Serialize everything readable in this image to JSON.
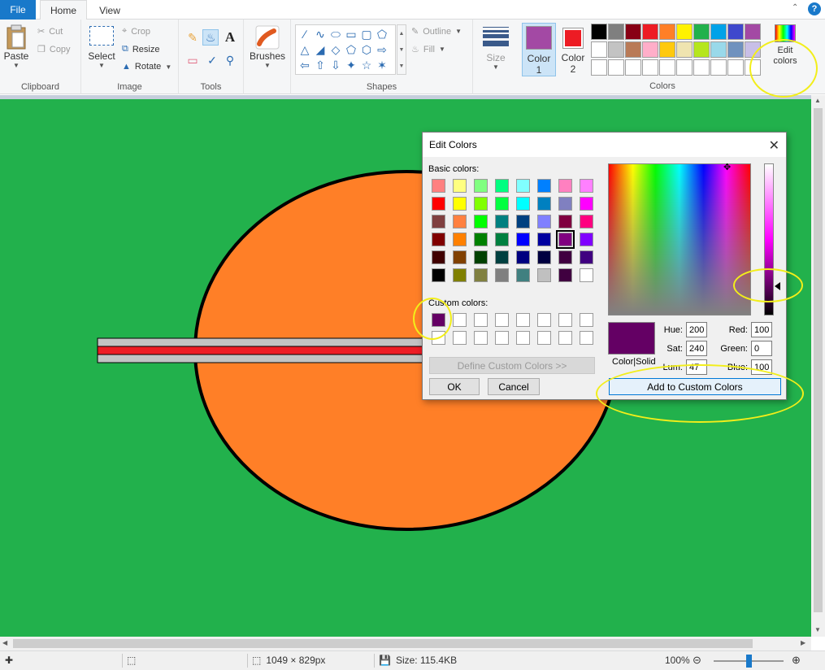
{
  "tabs": {
    "file": "File",
    "home": "Home",
    "view": "View",
    "help": "?"
  },
  "clipboard": {
    "paste": "Paste",
    "cut": "Cut",
    "copy": "Copy",
    "label": "Clipboard"
  },
  "image": {
    "select": "Select",
    "crop": "Crop",
    "resize": "Resize",
    "rotate": "Rotate",
    "label": "Image"
  },
  "tools": {
    "label": "Tools",
    "text_glyph": "A"
  },
  "brushes": {
    "label": "Brushes"
  },
  "shapes": {
    "label": "Shapes",
    "outline": "Outline",
    "fill": "Fill"
  },
  "size": {
    "label": "Size"
  },
  "colors": {
    "label": "Colors",
    "color1_label": "Color\n1",
    "color1_line1": "Color",
    "color1_line2": "1",
    "color2_line1": "Color",
    "color2_line2": "2",
    "color1": "#a349a4",
    "color2": "#ed1c24",
    "edit_line1": "Edit",
    "edit_line2": "colors",
    "palette_row1": [
      "#000000",
      "#7f7f7f",
      "#880015",
      "#ed1c24",
      "#ff7f27",
      "#fff200",
      "#22b14c",
      "#00a2e8",
      "#3f48cc",
      "#a349a4"
    ],
    "palette_row2": [
      "#ffffff",
      "#c3c3c3",
      "#b97a57",
      "#ffaec9",
      "#ffc90e",
      "#efe4b0",
      "#b5e61d",
      "#99d9ea",
      "#7092be",
      "#c8bfe7"
    ],
    "palette_row3": [
      "#ffffff",
      "#ffffff",
      "#ffffff",
      "#ffffff",
      "#ffffff",
      "#ffffff",
      "#ffffff",
      "#ffffff",
      "#ffffff",
      "#ffffff"
    ]
  },
  "canvas": {
    "background": "#22b14c",
    "ellipse_fill": "#ff7f27",
    "bar_fill": "#ed1c24",
    "bar_border": "#c3c3c3"
  },
  "status": {
    "dimensions": "1049 × 829px",
    "size": "Size: 115.4KB",
    "zoom": "100%",
    "zoom_level": 0.5
  },
  "dialog": {
    "title": "Edit Colors",
    "basic_colors_label": "Basic colors:",
    "custom_colors_label": "Custom colors:",
    "define_button": "Define Custom Colors >>",
    "ok": "OK",
    "cancel": "Cancel",
    "color_solid_label": "Color|Solid",
    "add_button": "Add to Custom Colors",
    "hue_label": "Hue:",
    "hue": "200",
    "sat_label": "Sat:",
    "sat": "240",
    "lum_label": "Lum:",
    "lum": "47",
    "red_label": "Red:",
    "red": "100",
    "green_label": "Green:",
    "green": "0",
    "blue_label": "Blue:",
    "blue": "100",
    "preview_color": "#640064",
    "basic_colors": [
      [
        "#ff8080",
        "#ffff80",
        "#80ff80",
        "#00ff80",
        "#80ffff",
        "#0080ff",
        "#ff80c0",
        "#ff80ff"
      ],
      [
        "#ff0000",
        "#ffff00",
        "#80ff00",
        "#00ff40",
        "#00ffff",
        "#0080c0",
        "#8080c0",
        "#ff00ff"
      ],
      [
        "#804040",
        "#ff8040",
        "#00ff00",
        "#008080",
        "#004080",
        "#8080ff",
        "#800040",
        "#ff0080"
      ],
      [
        "#800000",
        "#ff8000",
        "#008000",
        "#008040",
        "#0000ff",
        "#0000a0",
        "#800080",
        "#8000ff"
      ],
      [
        "#400000",
        "#804000",
        "#004000",
        "#004040",
        "#000080",
        "#000040",
        "#400040",
        "#400080"
      ],
      [
        "#000000",
        "#808000",
        "#808040",
        "#808080",
        "#408080",
        "#c0c0c0",
        "#400040",
        "#ffffff"
      ]
    ],
    "custom_colors": [
      [
        "#640064",
        "#ffffff",
        "#ffffff",
        "#ffffff",
        "#ffffff",
        "#ffffff",
        "#ffffff",
        "#ffffff"
      ],
      [
        "#ffffff",
        "#ffffff",
        "#ffffff",
        "#ffffff",
        "#ffffff",
        "#ffffff",
        "#ffffff",
        "#ffffff"
      ]
    ]
  }
}
